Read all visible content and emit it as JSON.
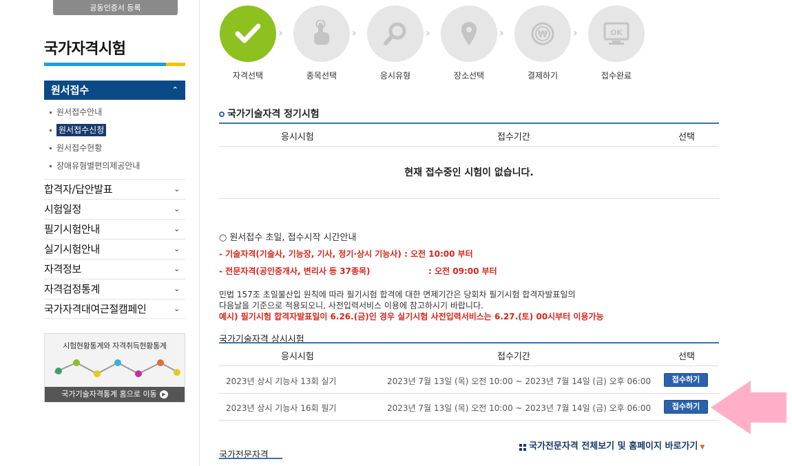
{
  "sidebar": {
    "cert_button": "공동인증서 등록",
    "title": "국가자격시험",
    "active_menu": "원서접수",
    "sub_items": [
      "원서접수안내",
      "원서접수신청",
      "원서접수현황",
      "장애유형별편의제공안내"
    ],
    "menu_items": [
      "합격자/답안발표",
      "시험일정",
      "필기시험안내",
      "실기시험안내",
      "자격정보",
      "자격검정통계",
      "국가자격대여근절캠페인"
    ],
    "stats_title": "시험현황통계와 자격취득현황통계",
    "stats_link": "국가기술자격통계 홈으로 이동"
  },
  "steps": [
    "자격선택",
    "종목선택",
    "응시유형",
    "장소선택",
    "결제하기",
    "접수완료"
  ],
  "regular": {
    "heading": "국가기술자격 정기시험",
    "col_exam": "응시시험",
    "col_period": "접수기간",
    "col_select": "선택",
    "empty_msg": "현재 접수중인 시험이 없습니다."
  },
  "notice": {
    "title": "○ 원서접수 초일, 접수시작 시간안내",
    "line1": "- 기술자격(기술사, 기능장, 기사, 정기·상시 기능사) : 오전 10:00 부터",
    "line2a": "- 전문자격(공인중개사, 변리사 등 37종목)",
    "line2b": ": 오전 09:00 부터",
    "para1": "민법 157조 초일불산입 원칙에 따라 필기시험 합격에 대한 면제기간은 당회차 필기시험 합격자발표일의",
    "para2": "다음날을 기준으로 적용되오니, 사전입력서비스 이용에 참고하시기 바랍니다.",
    "para3": "예시) 필기시험 합격자발표일이 6.26.(금)인 경우 실기시험 사전입력서비스는 6.27.(토) 00시부터 이용가능"
  },
  "ondemand": {
    "heading": "국가기술자격 상시시험",
    "col_exam": "응시시험",
    "col_period": "접수기간",
    "col_select": "선택",
    "rows": [
      {
        "exam": "2023년 상시 기능사 13회 실기",
        "period": "2023년 7월 13일 (목) 오전 10:00 ~ 2023년 7월 14일 (금) 오후 06:00",
        "button": "접수하기"
      },
      {
        "exam": "2023년 상시 기능사 16회 필기",
        "period": "2023년 7월 13일 (목) 오전 10:00 ~ 2023년 7월 14일 (금) 오후 06:00",
        "button": "접수하기"
      }
    ]
  },
  "professional": {
    "link": "국가전문자격 전체보기 및 홈페이지 바로가기",
    "heading": "국가전문자격"
  },
  "colors": {
    "accent": "#0b4a86",
    "done": "#8cc120",
    "button": "#2b62ad",
    "arrow": "#ffb0c8"
  }
}
